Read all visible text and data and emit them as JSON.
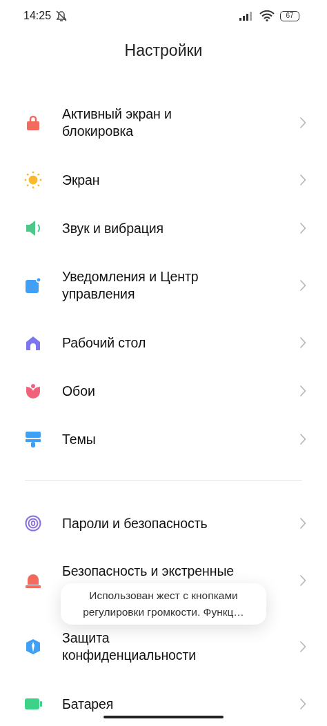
{
  "status_bar": {
    "time": "14:25",
    "battery": "67"
  },
  "title": "Настройки",
  "groups": [
    {
      "items": [
        {
          "lines": [
            "Активный экран и",
            "блокировка"
          ]
        },
        {
          "lines": [
            "Экран"
          ]
        },
        {
          "lines": [
            "Звук и вибрация"
          ]
        },
        {
          "lines": [
            "Уведомления и Центр",
            "управления"
          ]
        },
        {
          "lines": [
            "Рабочий стол"
          ]
        },
        {
          "lines": [
            "Обои"
          ]
        },
        {
          "lines": [
            "Темы"
          ]
        }
      ]
    },
    {
      "items": [
        {
          "lines": [
            "Пароли и безопасность"
          ]
        },
        {
          "lines": [
            "Безопасность и экстренные"
          ],
          "partly_hidden": true
        },
        {
          "lines": [
            "Защита",
            "конфиденциальности"
          ]
        },
        {
          "lines": [
            "Батарея"
          ]
        }
      ]
    }
  ],
  "toast": {
    "lines": [
      "Использован жест с кнопками",
      "регулировки громкости. Функц…"
    ]
  }
}
